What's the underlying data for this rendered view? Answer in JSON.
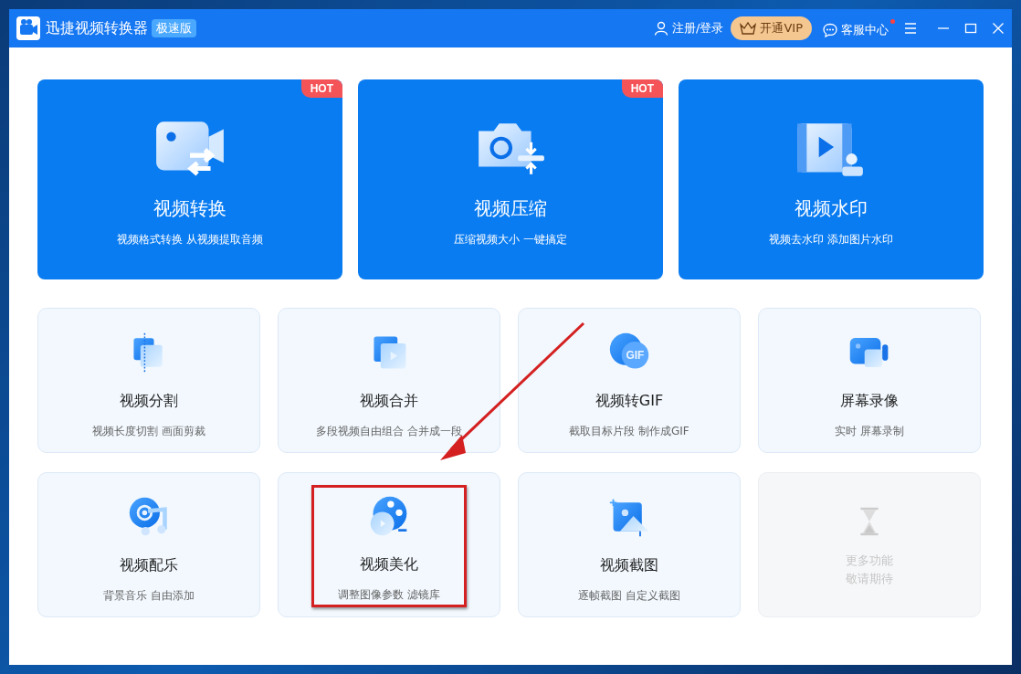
{
  "window": {
    "title": "迅捷视频转换器",
    "edition_badge": "极速版"
  },
  "header_actions": {
    "login": "注册/登录",
    "vip": "开通VIP",
    "support": "客服中心",
    "support_notification": true
  },
  "featured_tools": [
    {
      "kind": "convert",
      "title": "视频转换",
      "subtitle": "视频格式转换 从视频提取音频",
      "badge": "HOT"
    },
    {
      "kind": "compress",
      "title": "视频压缩",
      "subtitle": "压缩视频大小 一键搞定",
      "badge": "HOT"
    },
    {
      "kind": "watermark",
      "title": "视频水印",
      "subtitle": "视频去水印 添加图片水印"
    }
  ],
  "tools": [
    {
      "kind": "split",
      "title": "视频分割",
      "subtitle": "视频长度切割 画面剪裁",
      "disabled": false,
      "highlighted": false
    },
    {
      "kind": "merge",
      "title": "视频合并",
      "subtitle": "多段视频自由组合 合并成一段",
      "disabled": false,
      "highlighted": false
    },
    {
      "kind": "gif",
      "icon_text": "GIF",
      "title": "视频转GIF",
      "subtitle": "截取目标片段 制作成GIF",
      "disabled": false,
      "highlighted": false
    },
    {
      "kind": "record",
      "title": "屏幕录像",
      "subtitle": "实时 屏幕录制",
      "disabled": false,
      "highlighted": false
    },
    {
      "kind": "music",
      "title": "视频配乐",
      "subtitle": "背景音乐 自由添加",
      "disabled": false,
      "highlighted": false
    },
    {
      "kind": "beautify",
      "title": "视频美化",
      "subtitle": "调整图像参数 滤镜库",
      "disabled": false,
      "highlighted": true
    },
    {
      "kind": "screenshot",
      "title": "视频截图",
      "subtitle": "逐帧截图 自定义截图",
      "disabled": false,
      "highlighted": false
    },
    {
      "kind": "hourglass",
      "subtitle": "更多功能",
      "subtitle_2": "敬请期待",
      "disabled": true,
      "highlighted": false
    }
  ]
}
